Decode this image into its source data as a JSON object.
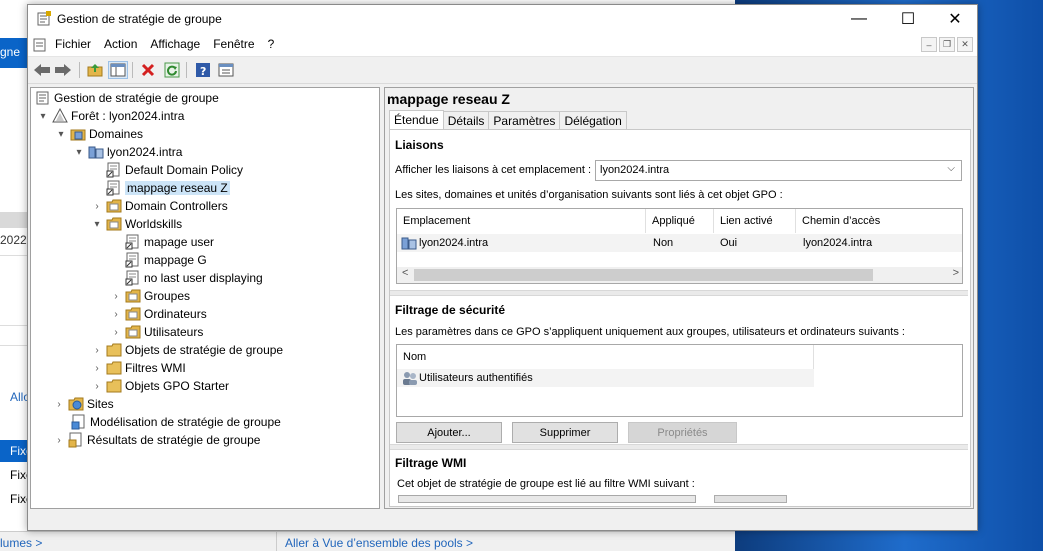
{
  "colors": {
    "accent": "#0a64c8",
    "selection": "#cce4f7"
  },
  "background": {
    "left_button": "gne",
    "year": "2022",
    "link_alloc": "Allo",
    "rows": [
      "Fixe",
      "Fixe",
      "Fixe"
    ],
    "bottom_link_1": "lumes >",
    "bottom_link_2": "Aller à Vue d’ensemble des pools >"
  },
  "window": {
    "title": "Gestion de stratégie de groupe",
    "controls": {
      "minimize": "—",
      "maximize": "☐",
      "close": "✕"
    }
  },
  "menu": [
    "Fichier",
    "Action",
    "Affichage",
    "Fenêtre",
    "?"
  ],
  "toolbar_icons": [
    "back-icon",
    "forward-icon",
    "folder-up-icon",
    "show-hide-tree-icon",
    "delete-icon",
    "refresh-icon",
    "help-icon",
    "properties-icon"
  ],
  "tree": [
    {
      "label": "Gestion de stratégie de groupe",
      "icon": "gpmc-icon",
      "expander": ""
    },
    {
      "label": "Forêt : lyon2024.intra",
      "icon": "forest-icon",
      "expander": "▾"
    },
    {
      "label": "Domaines",
      "icon": "domains-icon",
      "expander": "▾"
    },
    {
      "label": "lyon2024.intra",
      "icon": "domain-icon",
      "expander": "▾"
    },
    {
      "label": "Default Domain Policy",
      "icon": "gpo-link-icon",
      "expander": ""
    },
    {
      "label": "mappage reseau Z",
      "icon": "gpo-link-icon",
      "expander": ""
    },
    {
      "label": "Domain Controllers",
      "icon": "ou-icon",
      "expander": "›"
    },
    {
      "label": "Worldskills",
      "icon": "ou-icon",
      "expander": "▾"
    },
    {
      "label": "mapage user",
      "icon": "gpo-link-icon",
      "expander": ""
    },
    {
      "label": "mappage G",
      "icon": "gpo-link-icon",
      "expander": ""
    },
    {
      "label": "no last user displaying",
      "icon": "gpo-link-icon",
      "expander": ""
    },
    {
      "label": "Groupes",
      "icon": "ou-icon",
      "expander": "›"
    },
    {
      "label": "Ordinateurs",
      "icon": "ou-icon",
      "expander": "›"
    },
    {
      "label": "Utilisateurs",
      "icon": "ou-icon",
      "expander": "›"
    },
    {
      "label": "Objets de stratégie de groupe",
      "icon": "folder-icon",
      "expander": "›"
    },
    {
      "label": "Filtres WMI",
      "icon": "folder-icon",
      "expander": "›"
    },
    {
      "label": "Objets GPO Starter",
      "icon": "folder-icon",
      "expander": "›"
    },
    {
      "label": "Sites",
      "icon": "sites-icon",
      "expander": "›"
    },
    {
      "label": "Modélisation de stratégie de groupe",
      "icon": "modeling-icon",
      "expander": ""
    },
    {
      "label": "Résultats de stratégie de groupe",
      "icon": "results-icon",
      "expander": "›"
    }
  ],
  "details": {
    "title": "mappage reseau Z",
    "tabs": [
      "Étendue",
      "Détails",
      "Paramètres",
      "Délégation"
    ],
    "links": {
      "heading": "Liaisons",
      "location_label": "Afficher les liaisons à cet emplacement :",
      "location_value": "lyon2024.intra",
      "description": "Les sites, domaines et unités d’organisation suivants sont liés à cet objet GPO :",
      "columns": [
        "Emplacement",
        "Appliqué",
        "Lien activé",
        "Chemin d’accès"
      ],
      "rows": [
        {
          "location": "lyon2024.intra",
          "enforced": "Non",
          "enabled": "Oui",
          "path": "lyon2024.intra"
        }
      ]
    },
    "security": {
      "heading": "Filtrage de sécurité",
      "description": "Les paramètres dans ce GPO s’appliquent uniquement aux groupes, utilisateurs et ordinateurs suivants :",
      "column": "Nom",
      "rows": [
        "Utilisateurs authentifiés"
      ],
      "buttons": {
        "add": "Ajouter...",
        "remove": "Supprimer",
        "properties": "Propriétés"
      }
    },
    "wmi": {
      "heading": "Filtrage WMI",
      "description": "Cet objet de stratégie de groupe est lié au filtre WMI suivant :"
    }
  }
}
